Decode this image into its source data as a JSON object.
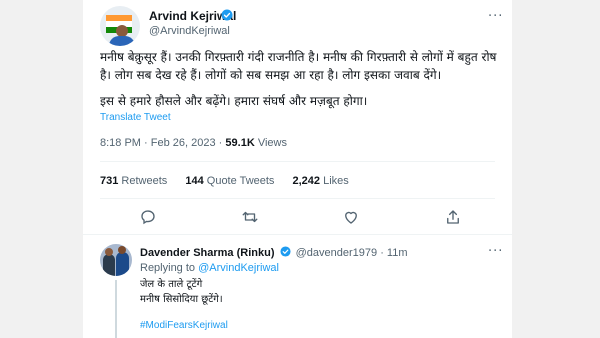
{
  "tweet": {
    "author_name": "Arvind Kejriwal",
    "author_handle": "@ArvindKejriwal",
    "more_label": "···",
    "paragraphs": [
      "मनीष बेक़ुसूर हैं। उनकी गिरफ़्तारी गंदी राजनीति है। मनीष की गिरफ़्तारी से लोगों में बहुत रोष है। लोग सब देख रहे हैं। लोगों को सब समझ आ रहा है। लोग इसका जवाब देंगे।",
      "इस से हमारे हौसले और बढ़ेंगे। हमारा संघर्ष और मज़बूत होगा।"
    ],
    "translate_label": "Translate Tweet",
    "time": "8:18 PM",
    "date": "Feb 26, 2023",
    "views_count": "59.1K",
    "views_label": "Views",
    "separator": "·",
    "stats": {
      "retweets_count": "731",
      "retweets_label": "Retweets",
      "quotes_count": "144",
      "quotes_label": "Quote Tweets",
      "likes_count": "2,242",
      "likes_label": "Likes"
    },
    "actions": [
      "reply-icon",
      "retweet-icon",
      "like-icon",
      "share-icon"
    ]
  },
  "reply": {
    "author_name": "Davender Sharma (Rinku)",
    "author_handle": "@davender1979",
    "separator": "·",
    "time_ago": "11m",
    "replying_to_label": "Replying to",
    "replying_to_handle": "@ArvindKejriwal",
    "text_lines": [
      "जेल के ताले टूटेंगे",
      "मनीष सिसोदिया छूटेंगे।"
    ],
    "hashtag": "#ModiFearsKejriwal",
    "more_label": "···"
  },
  "colors": {
    "accent": "#1d9bf0",
    "secondary_text": "#536471",
    "page_bg": "#f1f1f1"
  }
}
